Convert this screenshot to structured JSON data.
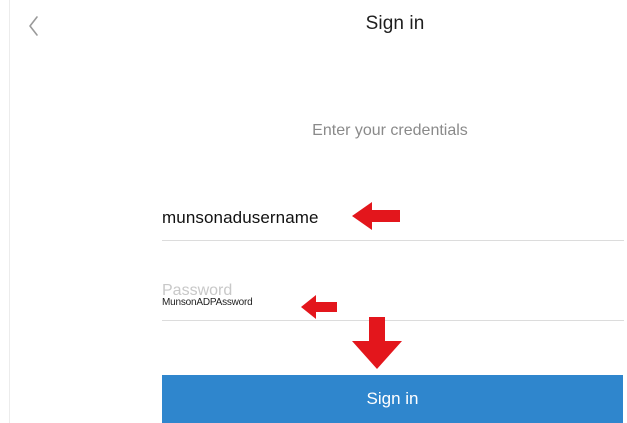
{
  "header": {
    "title": "Sign in",
    "back_icon": "chevron-left-icon"
  },
  "form": {
    "subtitle": "Enter your credentials",
    "username_value": "munsonadusername",
    "password_placeholder": "Password",
    "password_typed": "MunsonADPAssword",
    "submit_label": "Sign in"
  },
  "annotations": {
    "arrow_color": "#e3161c",
    "icons": [
      "arrow-left-icon",
      "arrow-left-icon",
      "arrow-down-icon"
    ]
  },
  "colors": {
    "button_background": "#2f86cd",
    "button_text": "#ffffff",
    "subtitle_text": "#8a8a8a",
    "placeholder_text": "#c8c8c8"
  }
}
